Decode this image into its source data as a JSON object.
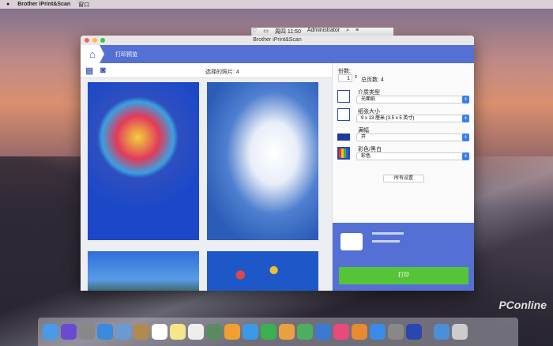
{
  "menubar": {
    "app": "Brother iPrint&Scan",
    "menu": "窗口",
    "clock": "周四 11:50",
    "user": "Administrator"
  },
  "window": {
    "title": "Brother iPrint&Scan",
    "header_title": "打印预览",
    "selected_photos": "选择的照片: 4"
  },
  "settings": {
    "copies_label": "份数:",
    "copies_value": "1",
    "total_pages": "总页数: 4",
    "media_type_label": "介质类型",
    "media_type_value": "光面纸",
    "paper_size_label": "纸张大小",
    "paper_size_value": "9 x 13 厘米 (3.5 x 5 英寸)",
    "borderless_label": "满幅",
    "borderless_value": "开",
    "color_label": "彩色/黑白",
    "color_value": "彩色",
    "all_settings": "所有设置"
  },
  "print_button": "打印",
  "watermark": "PConline"
}
